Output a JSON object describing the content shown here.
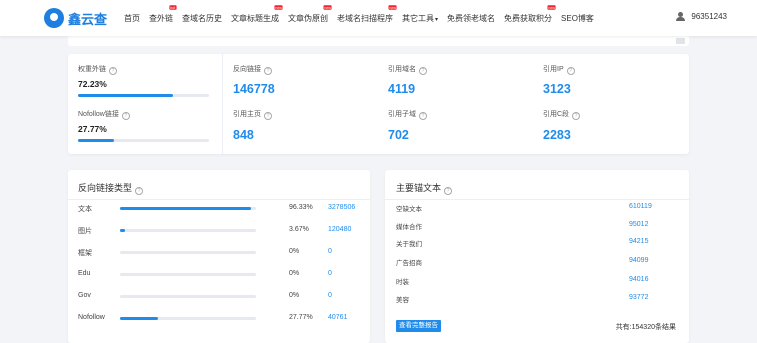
{
  "nav": {
    "logo_text": "鑫云查",
    "items": [
      {
        "label": "首页",
        "badge": ""
      },
      {
        "label": "查外链",
        "badge": "hot"
      },
      {
        "label": "查域名历史",
        "badge": ""
      },
      {
        "label": "文章标题生成",
        "badge": "new"
      },
      {
        "label": "文章伪原创",
        "badge": "new"
      },
      {
        "label": "老域名扫描程序",
        "badge": "new"
      },
      {
        "label": "其它工具",
        "badge": ""
      },
      {
        "label": "免费领老域名",
        "badge": ""
      },
      {
        "label": "免费获取积分",
        "badge": "new"
      },
      {
        "label": "SEO博客",
        "badge": ""
      }
    ],
    "user_id": "96351243"
  },
  "stats": {
    "weight_label": "权重外链",
    "weight_pct": "72.23%",
    "weight_fraction": 0.7223,
    "nofollow_label": "Nofollow链接",
    "nofollow_pct": "27.77%",
    "nofollow_fraction": 0.2777,
    "cells": [
      {
        "label": "反向链接",
        "value": "146778"
      },
      {
        "label": "引用主页",
        "value": "848"
      },
      {
        "label": "引用域名",
        "value": "4119"
      },
      {
        "label": "引用子域",
        "value": "702"
      },
      {
        "label": "引用IP",
        "value": "3123"
      },
      {
        "label": "引用C段",
        "value": "2283"
      }
    ]
  },
  "link_types": {
    "title": "反向链接类型",
    "rows": [
      {
        "name": "文本",
        "pct": "96.33%",
        "count": "3278506",
        "fraction": 0.9633
      },
      {
        "name": "图片",
        "pct": "3.67%",
        "count": "120480",
        "fraction": 0.0367
      },
      {
        "name": "框架",
        "pct": "0%",
        "count": "0",
        "fraction": 0
      },
      {
        "name": "Edu",
        "pct": "0%",
        "count": "0",
        "fraction": 0
      },
      {
        "name": "Gov",
        "pct": "0%",
        "count": "0",
        "fraction": 0
      },
      {
        "name": "Nofollow",
        "pct": "27.77%",
        "count": "40761",
        "fraction": 0.2777
      }
    ]
  },
  "anchors": {
    "title": "主要锚文本",
    "rows": [
      {
        "name": "空缺文本",
        "count": "610119"
      },
      {
        "name": "媒体合作",
        "count": "95012"
      },
      {
        "name": "关于我们",
        "count": "94215"
      },
      {
        "name": "广告招商",
        "count": "94099"
      },
      {
        "name": "时装",
        "count": "94016"
      },
      {
        "name": "美容",
        "count": "93772"
      }
    ],
    "report_button": "查看完整报告",
    "total_text": "共有:154320条结果"
  },
  "colors": {
    "accent": "#1f8ceb",
    "badge": "#f5222d"
  }
}
